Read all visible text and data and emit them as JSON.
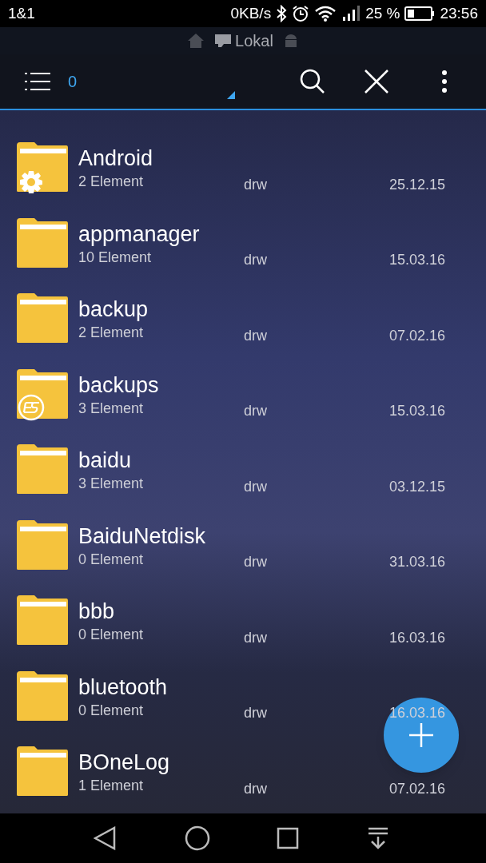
{
  "status_bar": {
    "carrier": "1&1",
    "speed": "0KB/s",
    "battery": "25 %",
    "time": "23:56"
  },
  "location_bar": {
    "label": "Lokal"
  },
  "toolbar": {
    "counter": "0"
  },
  "files": [
    {
      "name": "Android",
      "count": "2 Element",
      "permissions": "drw",
      "date": "25.12.15",
      "kind": "system"
    },
    {
      "name": "appmanager",
      "count": "10 Element",
      "permissions": "drw",
      "date": "15.03.16"
    },
    {
      "name": "backup",
      "count": "2 Element",
      "permissions": "drw",
      "date": "07.02.16"
    },
    {
      "name": "backups",
      "count": "3 Element",
      "permissions": "drw",
      "date": "15.03.16",
      "kind": "app"
    },
    {
      "name": "baidu",
      "count": "3 Element",
      "permissions": "drw",
      "date": "03.12.15"
    },
    {
      "name": "BaiduNetdisk",
      "count": "0 Element",
      "permissions": "drw",
      "date": "31.03.16"
    },
    {
      "name": "bbb",
      "count": "0 Element",
      "permissions": "drw",
      "date": "16.03.16"
    },
    {
      "name": "bluetooth",
      "count": "0 Element",
      "permissions": "drw",
      "date": "16.03.16"
    },
    {
      "name": "BOneLog",
      "count": "1 Element",
      "permissions": "drw",
      "date": "07.02.16"
    }
  ]
}
